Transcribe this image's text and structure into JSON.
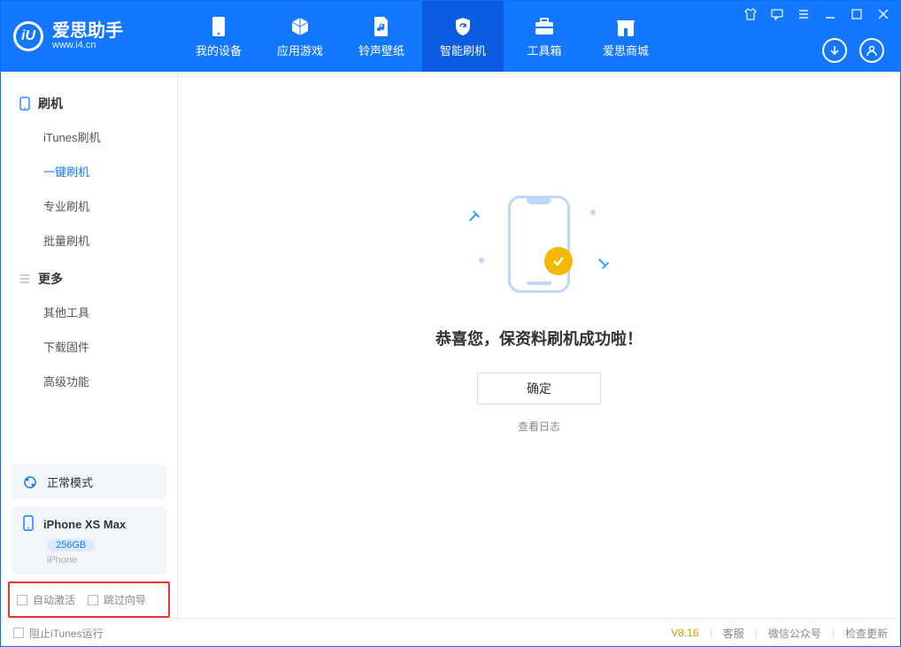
{
  "brand": {
    "logo_letter": "iU",
    "name_cn": "爱思助手",
    "name_en": "www.i4.cn"
  },
  "nav": {
    "items": [
      {
        "label": "我的设备"
      },
      {
        "label": "应用游戏"
      },
      {
        "label": "铃声壁纸"
      },
      {
        "label": "智能刷机"
      },
      {
        "label": "工具箱"
      },
      {
        "label": "爱思商城"
      }
    ]
  },
  "sidebar": {
    "group1": {
      "title": "刷机",
      "items": [
        {
          "label": "iTunes刷机"
        },
        {
          "label": "一键刷机"
        },
        {
          "label": "专业刷机"
        },
        {
          "label": "批量刷机"
        }
      ]
    },
    "group2": {
      "title": "更多",
      "items": [
        {
          "label": "其他工具"
        },
        {
          "label": "下载固件"
        },
        {
          "label": "高级功能"
        }
      ]
    },
    "mode_card": {
      "label": "正常模式"
    },
    "device_card": {
      "name": "iPhone XS Max",
      "capacity": "256GB",
      "type": "iPhone"
    },
    "bottom_checks": {
      "auto_activate": "自动激活",
      "skip_guide": "跳过向导"
    }
  },
  "main": {
    "success_text": "恭喜您，保资料刷机成功啦！",
    "ok_label": "确定",
    "view_log": "查看日志"
  },
  "footer": {
    "block_itunes": "阻止iTunes运行",
    "version": "V8.16",
    "links": {
      "service": "客服",
      "wechat": "微信公众号",
      "update": "检查更新"
    }
  }
}
